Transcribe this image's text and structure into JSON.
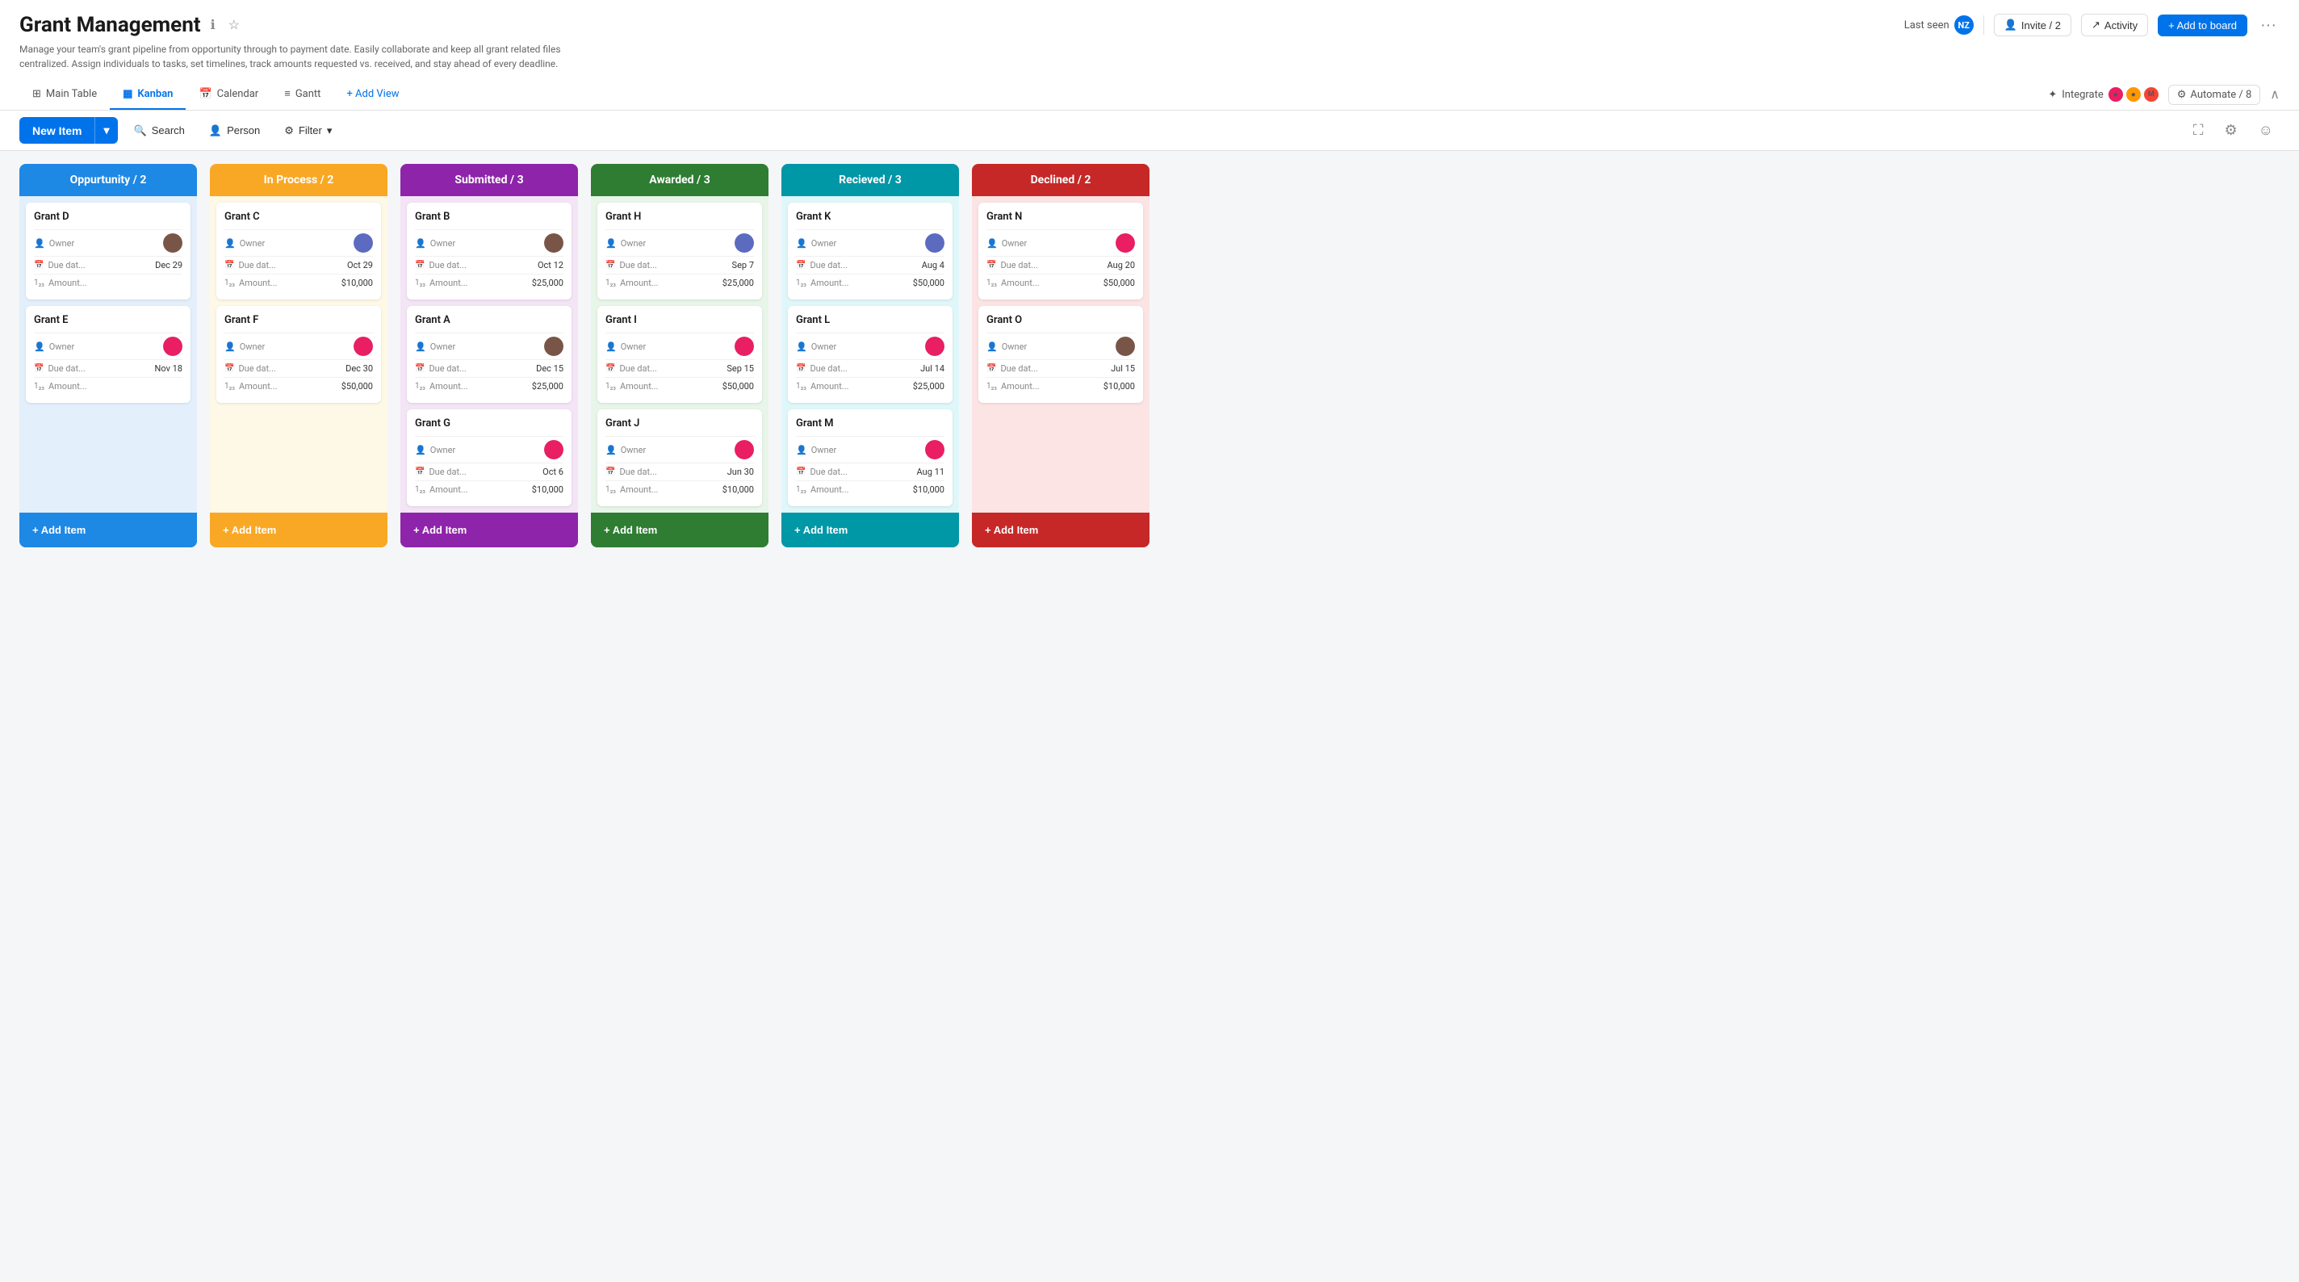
{
  "header": {
    "title": "Grant Management",
    "subtitle": "Manage your team's grant pipeline from opportunity through to payment date. Easily collaborate and keep all grant related files centralized. Assign individuals to tasks, set timelines, track amounts requested vs. received, and stay ahead of every deadline.",
    "last_seen_label": "Last seen",
    "last_seen_initials": "NZ",
    "invite_label": "Invite / 2",
    "activity_label": "Activity",
    "add_to_board_label": "+ Add to board",
    "integrate_label": "Integrate",
    "automate_label": "Automate / 8"
  },
  "nav": {
    "tabs": [
      {
        "id": "main-table",
        "label": "Main Table",
        "icon": "table-icon"
      },
      {
        "id": "kanban",
        "label": "Kanban",
        "icon": "kanban-icon",
        "active": true
      },
      {
        "id": "calendar",
        "label": "Calendar",
        "icon": "calendar-icon"
      },
      {
        "id": "gantt",
        "label": "Gantt",
        "icon": "gantt-icon"
      }
    ],
    "add_view_label": "+ Add View"
  },
  "toolbar": {
    "new_item_label": "New Item",
    "search_label": "Search",
    "person_label": "Person",
    "filter_label": "Filter"
  },
  "columns": [
    {
      "id": "opportunity",
      "title": "Oppurtunity / 2",
      "colorClass": "col-opportunity",
      "cards": [
        {
          "title": "Grant D",
          "owner_label": "Owner",
          "due_label": "Due dat...",
          "due_value": "Dec 29",
          "amount_label": "Amount...",
          "amount_value": "",
          "face": "face-a"
        },
        {
          "title": "Grant E",
          "owner_label": "Owner",
          "due_label": "Due dat...",
          "due_value": "Nov 18",
          "amount_label": "Amount...",
          "amount_value": "",
          "face": "face-c"
        }
      ],
      "add_label": "+ Add Item"
    },
    {
      "id": "inprocess",
      "title": "In Process / 2",
      "colorClass": "col-inprocess",
      "cards": [
        {
          "title": "Grant C",
          "owner_label": "Owner",
          "due_label": "Due dat...",
          "due_value": "Oct 29",
          "amount_label": "Amount...",
          "amount_value": "$10,000",
          "face": "face-b"
        },
        {
          "title": "Grant F",
          "owner_label": "Owner",
          "due_label": "Due dat...",
          "due_value": "Dec 30",
          "amount_label": "Amount...",
          "amount_value": "$50,000",
          "face": "face-c"
        }
      ],
      "add_label": "+ Add Item"
    },
    {
      "id": "submitted",
      "title": "Submitted / 3",
      "colorClass": "col-submitted",
      "cards": [
        {
          "title": "Grant B",
          "owner_label": "Owner",
          "due_label": "Due dat...",
          "due_value": "Oct 12",
          "amount_label": "Amount...",
          "amount_value": "$25,000",
          "face": "face-a"
        },
        {
          "title": "Grant A",
          "owner_label": "Owner",
          "due_label": "Due dat...",
          "due_value": "Dec 15",
          "amount_label": "Amount...",
          "amount_value": "$25,000",
          "face": "face-a"
        },
        {
          "title": "Grant G",
          "owner_label": "Owner",
          "due_label": "Due dat...",
          "due_value": "Oct 6",
          "amount_label": "Amount...",
          "amount_value": "$10,000",
          "face": "face-c"
        }
      ],
      "add_label": "+ Add Item"
    },
    {
      "id": "awarded",
      "title": "Awarded / 3",
      "colorClass": "col-awarded",
      "cards": [
        {
          "title": "Grant H",
          "owner_label": "Owner",
          "due_label": "Due dat...",
          "due_value": "Sep 7",
          "amount_label": "Amount...",
          "amount_value": "$25,000",
          "face": "face-b"
        },
        {
          "title": "Grant I",
          "owner_label": "Owner",
          "due_label": "Due dat...",
          "due_value": "Sep 15",
          "amount_label": "Amount...",
          "amount_value": "$50,000",
          "face": "face-c"
        },
        {
          "title": "Grant J",
          "owner_label": "Owner",
          "due_label": "Due dat...",
          "due_value": "Jun 30",
          "amount_label": "Amount...",
          "amount_value": "$10,000",
          "face": "face-c"
        }
      ],
      "add_label": "+ Add Item"
    },
    {
      "id": "received",
      "title": "Recieved / 3",
      "colorClass": "col-received",
      "cards": [
        {
          "title": "Grant K",
          "owner_label": "Owner",
          "due_label": "Due dat...",
          "due_value": "Aug 4",
          "amount_label": "Amount...",
          "amount_value": "$50,000",
          "face": "face-b"
        },
        {
          "title": "Grant L",
          "owner_label": "Owner",
          "due_label": "Due dat...",
          "due_value": "Jul 14",
          "amount_label": "Amount...",
          "amount_value": "$25,000",
          "face": "face-c"
        },
        {
          "title": "Grant M",
          "owner_label": "Owner",
          "due_label": "Due dat...",
          "due_value": "Aug 11",
          "amount_label": "Amount...",
          "amount_value": "$10,000",
          "face": "face-c"
        }
      ],
      "add_label": "+ Add Item"
    },
    {
      "id": "declined",
      "title": "Declined / 2",
      "colorClass": "col-declined",
      "cards": [
        {
          "title": "Grant N",
          "owner_label": "Owner",
          "due_label": "Due dat...",
          "due_value": "Aug 20",
          "amount_label": "Amount...",
          "amount_value": "$50,000",
          "face": "face-c"
        },
        {
          "title": "Grant O",
          "owner_label": "Owner",
          "due_label": "Due dat...",
          "due_value": "Jul 15",
          "amount_label": "Amount...",
          "amount_value": "$10,000",
          "face": "face-a"
        }
      ],
      "add_label": "+ Add Item"
    }
  ]
}
